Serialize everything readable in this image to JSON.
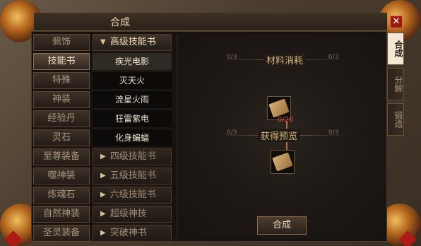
{
  "window": {
    "title": "合成",
    "close": "✕"
  },
  "categories": [
    {
      "label": "佩饰",
      "active": false
    },
    {
      "label": "技能书",
      "active": true
    },
    {
      "label": "特殊",
      "active": false
    },
    {
      "label": "神装",
      "active": false
    },
    {
      "label": "经验丹",
      "active": false
    },
    {
      "label": "灵石",
      "active": false
    },
    {
      "label": "至尊装备",
      "active": false
    },
    {
      "label": "噬神装",
      "active": false
    },
    {
      "label": "炼魂石",
      "active": false
    },
    {
      "label": "自然神装",
      "active": false
    },
    {
      "label": "圣灵装备",
      "active": false
    }
  ],
  "recipes": {
    "open_group": "高级技能书",
    "items": [
      "疾光电影",
      "灭天火",
      "流星火雨",
      "狂雷紫电",
      "化身蝙蝠"
    ],
    "collapsed_groups": [
      "四级技能书",
      "五级技能书",
      "六级技能书",
      "超级神技",
      "突破神书"
    ]
  },
  "main": {
    "materials_label": "材料消耗",
    "result_label": "获得预览",
    "material_count": "0/20",
    "corner_counts": [
      "0/3",
      "0/3",
      "0/3",
      "0/3"
    ],
    "craft_button": "合成"
  },
  "tabs": [
    "合成",
    "分解",
    "锻造"
  ],
  "colors": {
    "accent": "#d4b47c",
    "close": "#9b1a12",
    "count": "#cf4a3a"
  }
}
